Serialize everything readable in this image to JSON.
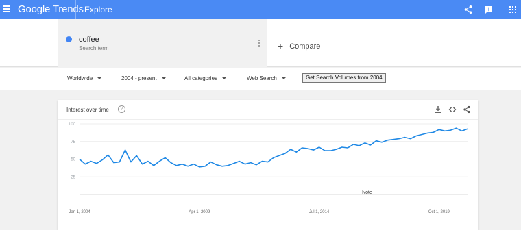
{
  "header": {
    "brand_google": "Google",
    "brand_trends": "Trends",
    "page": "Explore",
    "icons": [
      "menu-icon",
      "share-icon",
      "feedback-icon",
      "apps-icon"
    ],
    "color": "#4a8af4"
  },
  "search_term": {
    "name": "coffee",
    "subtitle": "Search term",
    "color": "#4285f4"
  },
  "compare": {
    "label": "Compare"
  },
  "filters": {
    "region": "Worldwide",
    "time": "2004 - present",
    "category": "All categories",
    "search_type": "Web Search",
    "volumes_button": "Get Search Volumes from 2004"
  },
  "card": {
    "title": "Interest over time",
    "icons": [
      "help-icon",
      "download-icon",
      "embed-icon",
      "share-icon"
    ]
  },
  "chart_data": {
    "type": "line",
    "title": "Interest over time",
    "y_ticks": [
      25,
      50,
      75,
      100
    ],
    "ylim": [
      0,
      100
    ],
    "x_tick_labels": [
      "Jan 1, 2004",
      "Apr 1, 2009",
      "Jul 1, 2014",
      "Oct 1, 2019"
    ],
    "x_tick_dates": [
      2004.0,
      2009.25,
      2014.5,
      2019.75
    ],
    "x_range": [
      2004.0,
      2021.0
    ],
    "note": "Note",
    "note_date": 2016.6,
    "grid": true,
    "series": [
      {
        "name": "coffee",
        "color": "#1e88e5",
        "x": [
          2004.0,
          2004.25,
          2004.5,
          2004.75,
          2005.0,
          2005.25,
          2005.5,
          2005.75,
          2006.0,
          2006.25,
          2006.5,
          2006.75,
          2007.0,
          2007.25,
          2007.5,
          2007.75,
          2008.0,
          2008.25,
          2008.5,
          2008.75,
          2009.0,
          2009.25,
          2009.5,
          2009.75,
          2010.0,
          2010.25,
          2010.5,
          2010.75,
          2011.0,
          2011.25,
          2011.5,
          2011.75,
          2012.0,
          2012.25,
          2012.5,
          2012.75,
          2013.0,
          2013.25,
          2013.5,
          2013.75,
          2014.0,
          2014.25,
          2014.5,
          2014.75,
          2015.0,
          2015.25,
          2015.5,
          2015.75,
          2016.0,
          2016.25,
          2016.5,
          2016.75,
          2017.0,
          2017.25,
          2017.5,
          2017.75,
          2018.0,
          2018.25,
          2018.5,
          2018.75,
          2019.0,
          2019.25,
          2019.5,
          2019.75,
          2020.0,
          2020.25,
          2020.5,
          2020.75,
          2021.0
        ],
        "values": [
          50,
          43,
          47,
          44,
          49,
          56,
          45,
          46,
          63,
          46,
          55,
          43,
          47,
          41,
          47,
          52,
          45,
          41,
          43,
          40,
          43,
          39,
          40,
          46,
          42,
          40,
          41,
          44,
          47,
          43,
          45,
          42,
          47,
          46,
          52,
          55,
          58,
          64,
          60,
          66,
          65,
          63,
          67,
          62,
          62,
          64,
          67,
          66,
          71,
          69,
          73,
          70,
          76,
          74,
          77,
          78,
          79,
          81,
          79,
          83,
          85,
          87,
          88,
          92,
          90,
          91,
          94,
          90,
          93
        ]
      }
    ]
  }
}
